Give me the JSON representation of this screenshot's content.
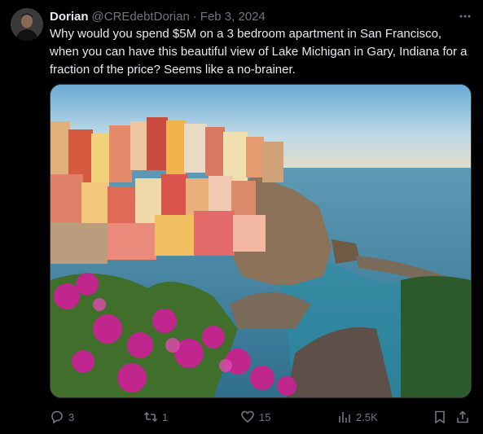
{
  "author": {
    "name": "Dorian",
    "handle": "@CREdebtDorian",
    "separator": "·",
    "date": "Feb 3, 2024"
  },
  "tweet": {
    "text": "Why would you spend $5M on a 3 bedroom apartment in San Francisco, when you can have this beautiful view  of Lake Michigan in Gary, Indiana for a fraction of the price? Seems like a no-brainer."
  },
  "metrics": {
    "replies": "3",
    "reposts": "1",
    "likes": "15",
    "views": "2.5K"
  },
  "icons": {
    "more": "more-options-icon",
    "reply": "reply-icon",
    "repost": "repost-icon",
    "like": "like-icon",
    "views": "views-icon",
    "bookmark": "bookmark-icon",
    "share": "share-icon"
  },
  "colors": {
    "background": "#000000",
    "primary_text": "#e7e9ea",
    "secondary_text": "#71767b",
    "border": "#2f3336"
  }
}
